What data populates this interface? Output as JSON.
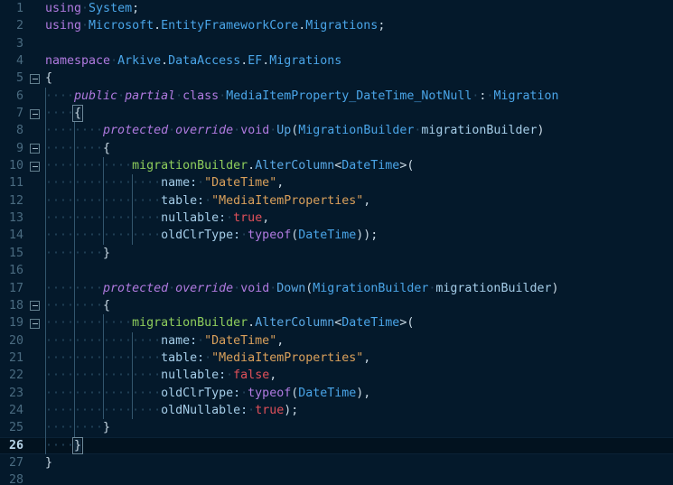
{
  "editor": {
    "background_color": "#04192b",
    "active_line_color": "#02121f",
    "gutter_color": "#4a6b80",
    "language": "csharp",
    "active_line_number": 26,
    "total_lines": 28,
    "whitespace_dot": "·",
    "fold_icon_name": "fold-collapse-icon",
    "colors": {
      "keyword": "#b07ae0",
      "type": "#4aa5e8",
      "method": "#5aa9e6",
      "local_variable": "#8fce5c",
      "parameter": "#a5cde8",
      "string": "#d9a05b",
      "boolean": "#e0505a",
      "punctuation": "#c9d9e4",
      "whitespace_guide": "#33566e",
      "line_number": "#4a6b80",
      "line_number_active": "#b8d4e8"
    }
  },
  "lines": [
    {
      "num": "1",
      "fold": false,
      "indent_guides": [],
      "tokens": [
        {
          "t": "using",
          "c": "kw"
        },
        {
          "t": "·",
          "c": "ws"
        },
        {
          "t": "System",
          "c": "type"
        },
        {
          "t": ";",
          "c": "punct"
        }
      ]
    },
    {
      "num": "2",
      "fold": false,
      "indent_guides": [],
      "tokens": [
        {
          "t": "using",
          "c": "kw"
        },
        {
          "t": "·",
          "c": "ws"
        },
        {
          "t": "Microsoft",
          "c": "type"
        },
        {
          "t": ".",
          "c": "punct"
        },
        {
          "t": "EntityFrameworkCore",
          "c": "type"
        },
        {
          "t": ".",
          "c": "punct"
        },
        {
          "t": "Migrations",
          "c": "type"
        },
        {
          "t": ";",
          "c": "punct"
        }
      ]
    },
    {
      "num": "3",
      "fold": false,
      "indent_guides": [],
      "tokens": []
    },
    {
      "num": "4",
      "fold": false,
      "indent_guides": [],
      "tokens": [
        {
          "t": "namespace",
          "c": "kw"
        },
        {
          "t": "·",
          "c": "ws"
        },
        {
          "t": "Arkive",
          "c": "type"
        },
        {
          "t": ".",
          "c": "punct"
        },
        {
          "t": "DataAccess",
          "c": "type"
        },
        {
          "t": ".",
          "c": "punct"
        },
        {
          "t": "EF",
          "c": "type"
        },
        {
          "t": ".",
          "c": "punct"
        },
        {
          "t": "Migrations",
          "c": "type"
        }
      ]
    },
    {
      "num": "5",
      "fold": true,
      "indent_guides": [],
      "tokens": [
        {
          "t": "{",
          "c": "punct"
        }
      ]
    },
    {
      "num": "6",
      "fold": false,
      "indent_guides": [
        0
      ],
      "tokens": [
        {
          "t": "····",
          "c": "ws"
        },
        {
          "t": "public",
          "c": "kw-it"
        },
        {
          "t": "·",
          "c": "ws"
        },
        {
          "t": "partial",
          "c": "kw-it"
        },
        {
          "t": "·",
          "c": "ws"
        },
        {
          "t": "class",
          "c": "kw"
        },
        {
          "t": "·",
          "c": "ws"
        },
        {
          "t": "MediaItemProperty_DateTime_NotNull",
          "c": "type"
        },
        {
          "t": "·",
          "c": "ws"
        },
        {
          "t": ":",
          "c": "punct"
        },
        {
          "t": "·",
          "c": "ws"
        },
        {
          "t": "Migration",
          "c": "type"
        }
      ]
    },
    {
      "num": "7",
      "fold": true,
      "indent_guides": [
        0
      ],
      "tokens": [
        {
          "t": "····",
          "c": "ws"
        },
        {
          "t": "{",
          "c": "punct",
          "match": true
        }
      ]
    },
    {
      "num": "8",
      "fold": false,
      "indent_guides": [
        0,
        1
      ],
      "tokens": [
        {
          "t": "········",
          "c": "ws"
        },
        {
          "t": "protected",
          "c": "kw-it"
        },
        {
          "t": "·",
          "c": "ws"
        },
        {
          "t": "override",
          "c": "kw-it"
        },
        {
          "t": "·",
          "c": "ws"
        },
        {
          "t": "void",
          "c": "kw"
        },
        {
          "t": "·",
          "c": "ws"
        },
        {
          "t": "Up",
          "c": "method"
        },
        {
          "t": "(",
          "c": "punct"
        },
        {
          "t": "MigrationBuilder",
          "c": "type"
        },
        {
          "t": "·",
          "c": "ws"
        },
        {
          "t": "migrationBuilder",
          "c": "param"
        },
        {
          "t": ")",
          "c": "punct"
        }
      ]
    },
    {
      "num": "9",
      "fold": true,
      "indent_guides": [
        0,
        1
      ],
      "tokens": [
        {
          "t": "········",
          "c": "ws"
        },
        {
          "t": "{",
          "c": "punct"
        }
      ]
    },
    {
      "num": "10",
      "fold": true,
      "indent_guides": [
        0,
        1,
        2
      ],
      "tokens": [
        {
          "t": "············",
          "c": "ws"
        },
        {
          "t": "migrationBuilder",
          "c": "local"
        },
        {
          "t": ".",
          "c": "punct"
        },
        {
          "t": "AlterColumn",
          "c": "method"
        },
        {
          "t": "<",
          "c": "punct"
        },
        {
          "t": "DateTime",
          "c": "type"
        },
        {
          "t": ">",
          "c": "punct"
        },
        {
          "t": "(",
          "c": "punct"
        }
      ]
    },
    {
      "num": "11",
      "fold": false,
      "indent_guides": [
        0,
        1,
        2,
        3
      ],
      "tokens": [
        {
          "t": "················",
          "c": "ws"
        },
        {
          "t": "name:",
          "c": "param"
        },
        {
          "t": "·",
          "c": "ws"
        },
        {
          "t": "\"DateTime\"",
          "c": "str"
        },
        {
          "t": ",",
          "c": "punct"
        }
      ]
    },
    {
      "num": "12",
      "fold": false,
      "indent_guides": [
        0,
        1,
        2,
        3
      ],
      "tokens": [
        {
          "t": "················",
          "c": "ws"
        },
        {
          "t": "table:",
          "c": "param"
        },
        {
          "t": "·",
          "c": "ws"
        },
        {
          "t": "\"MediaItemProperties\"",
          "c": "str"
        },
        {
          "t": ",",
          "c": "punct"
        }
      ]
    },
    {
      "num": "13",
      "fold": false,
      "indent_guides": [
        0,
        1,
        2,
        3
      ],
      "tokens": [
        {
          "t": "················",
          "c": "ws"
        },
        {
          "t": "nullable:",
          "c": "param"
        },
        {
          "t": "·",
          "c": "ws"
        },
        {
          "t": "true",
          "c": "bool"
        },
        {
          "t": ",",
          "c": "punct"
        }
      ]
    },
    {
      "num": "14",
      "fold": false,
      "indent_guides": [
        0,
        1,
        2,
        3
      ],
      "tokens": [
        {
          "t": "················",
          "c": "ws"
        },
        {
          "t": "oldClrType:",
          "c": "param"
        },
        {
          "t": "·",
          "c": "ws"
        },
        {
          "t": "typeof",
          "c": "kw"
        },
        {
          "t": "(",
          "c": "punct"
        },
        {
          "t": "DateTime",
          "c": "type"
        },
        {
          "t": "));",
          "c": "punct"
        }
      ]
    },
    {
      "num": "15",
      "fold": false,
      "indent_guides": [
        0,
        1
      ],
      "tokens": [
        {
          "t": "········",
          "c": "ws"
        },
        {
          "t": "}",
          "c": "punct"
        }
      ]
    },
    {
      "num": "16",
      "fold": false,
      "indent_guides": [
        0,
        1
      ],
      "tokens": []
    },
    {
      "num": "17",
      "fold": false,
      "indent_guides": [
        0,
        1
      ],
      "tokens": [
        {
          "t": "········",
          "c": "ws"
        },
        {
          "t": "protected",
          "c": "kw-it"
        },
        {
          "t": "·",
          "c": "ws"
        },
        {
          "t": "override",
          "c": "kw-it"
        },
        {
          "t": "·",
          "c": "ws"
        },
        {
          "t": "void",
          "c": "kw"
        },
        {
          "t": "·",
          "c": "ws"
        },
        {
          "t": "Down",
          "c": "method"
        },
        {
          "t": "(",
          "c": "punct"
        },
        {
          "t": "MigrationBuilder",
          "c": "type"
        },
        {
          "t": "·",
          "c": "ws"
        },
        {
          "t": "migrationBuilder",
          "c": "param"
        },
        {
          "t": ")",
          "c": "punct"
        }
      ]
    },
    {
      "num": "18",
      "fold": true,
      "indent_guides": [
        0,
        1
      ],
      "tokens": [
        {
          "t": "········",
          "c": "ws"
        },
        {
          "t": "{",
          "c": "punct"
        }
      ]
    },
    {
      "num": "19",
      "fold": true,
      "indent_guides": [
        0,
        1,
        2
      ],
      "tokens": [
        {
          "t": "············",
          "c": "ws"
        },
        {
          "t": "migrationBuilder",
          "c": "local"
        },
        {
          "t": ".",
          "c": "punct"
        },
        {
          "t": "AlterColumn",
          "c": "method"
        },
        {
          "t": "<",
          "c": "punct"
        },
        {
          "t": "DateTime",
          "c": "type"
        },
        {
          "t": ">",
          "c": "punct"
        },
        {
          "t": "(",
          "c": "punct"
        }
      ]
    },
    {
      "num": "20",
      "fold": false,
      "indent_guides": [
        0,
        1,
        2,
        3
      ],
      "tokens": [
        {
          "t": "················",
          "c": "ws"
        },
        {
          "t": "name:",
          "c": "param"
        },
        {
          "t": "·",
          "c": "ws"
        },
        {
          "t": "\"DateTime\"",
          "c": "str"
        },
        {
          "t": ",",
          "c": "punct"
        }
      ]
    },
    {
      "num": "21",
      "fold": false,
      "indent_guides": [
        0,
        1,
        2,
        3
      ],
      "tokens": [
        {
          "t": "················",
          "c": "ws"
        },
        {
          "t": "table:",
          "c": "param"
        },
        {
          "t": "·",
          "c": "ws"
        },
        {
          "t": "\"MediaItemProperties\"",
          "c": "str"
        },
        {
          "t": ",",
          "c": "punct"
        }
      ]
    },
    {
      "num": "22",
      "fold": false,
      "indent_guides": [
        0,
        1,
        2,
        3
      ],
      "tokens": [
        {
          "t": "················",
          "c": "ws"
        },
        {
          "t": "nullable:",
          "c": "param"
        },
        {
          "t": "·",
          "c": "ws"
        },
        {
          "t": "false",
          "c": "bool"
        },
        {
          "t": ",",
          "c": "punct"
        }
      ]
    },
    {
      "num": "23",
      "fold": false,
      "indent_guides": [
        0,
        1,
        2,
        3
      ],
      "tokens": [
        {
          "t": "················",
          "c": "ws"
        },
        {
          "t": "oldClrType:",
          "c": "param"
        },
        {
          "t": "·",
          "c": "ws"
        },
        {
          "t": "typeof",
          "c": "kw"
        },
        {
          "t": "(",
          "c": "punct"
        },
        {
          "t": "DateTime",
          "c": "type"
        },
        {
          "t": "),",
          "c": "punct"
        }
      ]
    },
    {
      "num": "24",
      "fold": false,
      "indent_guides": [
        0,
        1,
        2,
        3
      ],
      "tokens": [
        {
          "t": "················",
          "c": "ws"
        },
        {
          "t": "oldNullable:",
          "c": "param"
        },
        {
          "t": "·",
          "c": "ws"
        },
        {
          "t": "true",
          "c": "bool"
        },
        {
          "t": ");",
          "c": "punct"
        }
      ]
    },
    {
      "num": "25",
      "fold": false,
      "indent_guides": [
        0,
        1
      ],
      "tokens": [
        {
          "t": "········",
          "c": "ws"
        },
        {
          "t": "}",
          "c": "punct"
        }
      ]
    },
    {
      "num": "26",
      "fold": false,
      "active": true,
      "indent_guides": [
        0
      ],
      "tokens": [
        {
          "t": "····",
          "c": "ws"
        },
        {
          "t": "}",
          "c": "punct",
          "match": true
        }
      ]
    },
    {
      "num": "27",
      "fold": false,
      "indent_guides": [],
      "tokens": [
        {
          "t": "}",
          "c": "punct"
        }
      ]
    },
    {
      "num": "28",
      "fold": false,
      "indent_guides": [],
      "tokens": []
    }
  ]
}
